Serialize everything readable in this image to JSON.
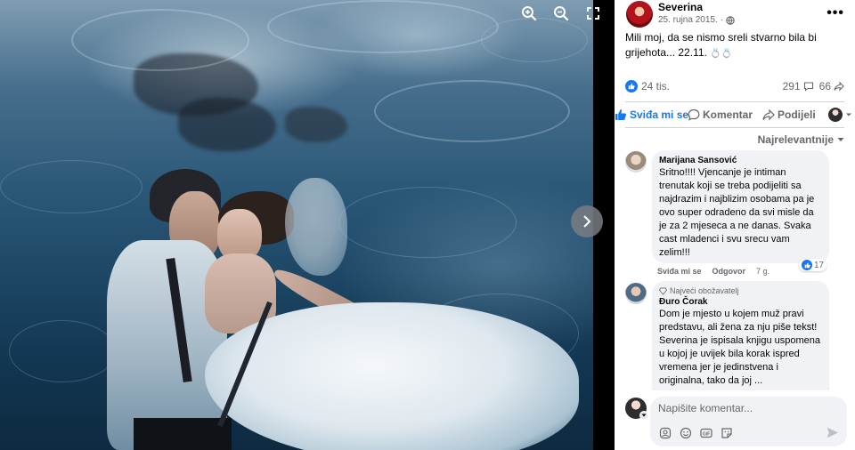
{
  "viewer": {
    "photo_alt": "",
    "controls": [
      "zoom-in-icon",
      "zoom-out-icon",
      "fullscreen-icon"
    ],
    "next_icon": "chevron-right-icon"
  },
  "post": {
    "author": "Severina",
    "date": "25. rujna 2015.",
    "privacy_icon": "globe-icon",
    "text": "Mili moj, da se nismo sreli stvarno bila bi grijehota... 22.11.",
    "emoji": "💍💍",
    "reactions_count": "24 tis.",
    "comments_count": "291",
    "shares_count": "66"
  },
  "actions": {
    "like": "Sviđa mi se",
    "comment": "Komentar",
    "share": "Podijeli"
  },
  "sort_label": "Najrelevantnije",
  "comments": [
    {
      "name": "Marijana Sansović",
      "text": "Sritno!!!! Vjencanje je intiman trenutak koji se treba podijeliti sa najdrazim i najblizim osobama pa je ovo super odradeno da svi misle da je za 2 mjeseca a ne danas. Svaka cast mladenci i svu srecu vam zelim!!!",
      "like_label": "Sviđa mi se",
      "reply_label": "Odgovor",
      "time": "7 g.",
      "likes": "17"
    },
    {
      "badge": "Najveći obožavatelj",
      "name": "Đuro Čorak",
      "text": "Dom je mjesto u kojem muž pravi predstavu, ali žena za nju piše tekst! Severina je ispisala knjigu uspomena u kojoj je uvijek bila korak ispred vremena jer je jedinstvena i originalna, tako da joj ..."
    }
  ],
  "composer": {
    "placeholder": "Napišite komentar..."
  },
  "colors": {
    "accent": "#1877f2",
    "panel_bg": "#ffffff",
    "bubble_bg": "#f0f2f5",
    "secondary_text": "#65676b"
  }
}
